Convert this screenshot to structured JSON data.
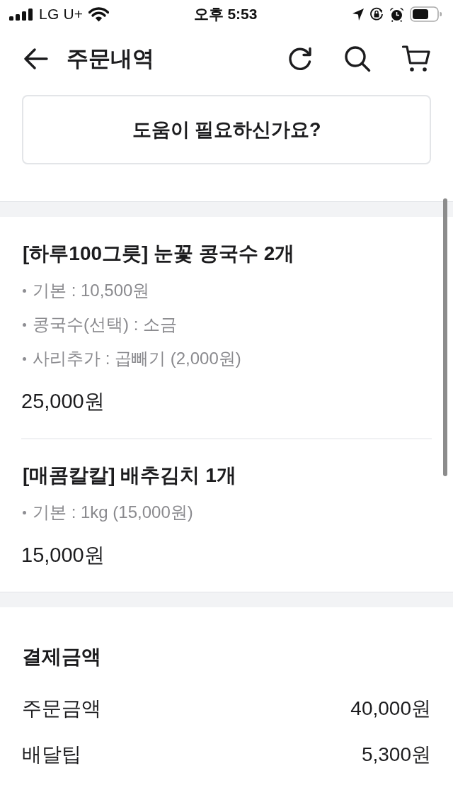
{
  "status_bar": {
    "carrier": "LG U+",
    "time": "오후 5:53"
  },
  "header": {
    "title": "주문내역"
  },
  "help_button": {
    "label": "도움이 필요하신가요?"
  },
  "order_items": [
    {
      "title": "[하루100그릇] 눈꽃 콩국수 2개",
      "options": [
        "기본 : 10,500원",
        "콩국수(선택) : 소금",
        "사리추가 : 곱빼기 (2,000원)"
      ],
      "price": "25,000원"
    },
    {
      "title": "[매콤칼칼] 배추김치 1개",
      "options": [
        "기본 : 1kg (15,000원)"
      ],
      "price": "15,000원"
    }
  ],
  "payment": {
    "title": "결제금액",
    "rows": [
      {
        "label": "주문금액",
        "value": "40,000원"
      },
      {
        "label": "배달팁",
        "value": "5,300원"
      }
    ]
  }
}
